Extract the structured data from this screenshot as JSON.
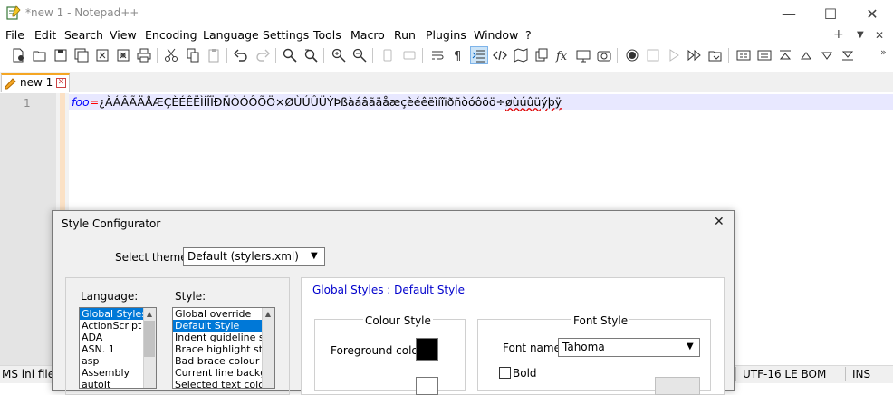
{
  "window": {
    "title": "*new 1 - Notepad++",
    "minimize": "—",
    "maximize": "☐",
    "close": "✕"
  },
  "menu": {
    "items": [
      "File",
      "Edit",
      "Search",
      "View",
      "Encoding",
      "Language",
      "Settings",
      "Tools",
      "Macro",
      "Run",
      "Plugins",
      "Window",
      "?"
    ],
    "right": [
      "+",
      "▼",
      "✕"
    ]
  },
  "tab": {
    "label": "new 1"
  },
  "editor": {
    "line_number": "1",
    "keyword": "foo",
    "operator": "=",
    "value_plain": "¿ÀÁÂÃÄÅÆÇÈÉÊËÌÍÎÏÐÑÒÓÔÕÖ×ØÙÚÛÜÝÞßàáâãäåæçèéêëìíîïðñòóôõö÷",
    "value_squiggle": "øùúûüýþÿ"
  },
  "status": {
    "left": "MS ini file",
    "encoding": "UTF-16 LE BOM",
    "mode": "INS"
  },
  "dialog": {
    "title": "Style Configurator",
    "close": "✕",
    "theme_label": "Select theme:",
    "theme_value": "Default (stylers.xml)",
    "language_label": "Language:",
    "style_label": "Style:",
    "languages": [
      "Global Styles",
      "ActionScript",
      "ADA",
      "ASN. 1",
      "asp",
      "Assembly",
      "autoIt"
    ],
    "styles": [
      "Global override",
      "Default Style",
      "Indent guideline sty",
      "Brace highlight style",
      "Bad brace colour",
      "Current line backgro",
      "Selected text colour"
    ],
    "panel_title": "Global Styles : Default Style",
    "colour_style": "Colour Style",
    "foreground_label": "Foreground colour",
    "font_style": "Font Style",
    "font_name_label": "Font name:",
    "font_name_value": "Tahoma",
    "bold_label": "Bold"
  },
  "colors": {
    "accent": "#0078d7",
    "keyword": "#0000ff",
    "operator": "#ff0000",
    "current_line": "#e8e8ff",
    "tab_indicator": "#f5a623"
  }
}
